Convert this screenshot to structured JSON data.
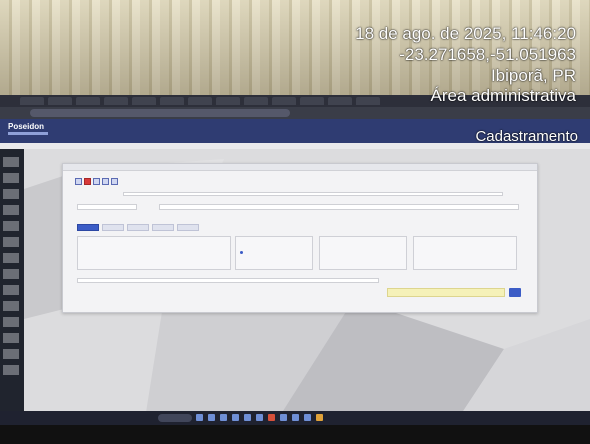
{
  "overlay": {
    "datetime": "18 de ago. de 2025, 11:46:20",
    "coordinates": "-23.271658,-51.051963",
    "city": "Ibiporã, PR",
    "area": "Área administrativa",
    "section": "Cadastramento"
  },
  "screen_app": {
    "logo": "Poseidon"
  },
  "icons": [
    "app-logo-icon",
    "search-icon",
    "radio-icon",
    "go-arrow-icon"
  ],
  "colors": {
    "app_header": "#2f3c72",
    "accent": "#3b5cc6",
    "highlight_field": "#f5f1b8"
  }
}
